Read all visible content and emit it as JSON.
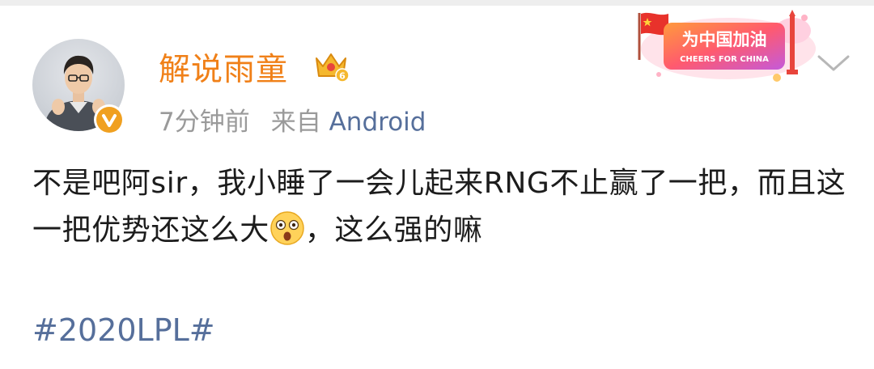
{
  "post": {
    "author": {
      "name": "解说雨童",
      "vip_level": "6",
      "avatar_icon": "person-avatar",
      "verified_icon": "verified-v-icon"
    },
    "meta": {
      "time": "7分钟前",
      "source_prefix": "来自",
      "source": "Android"
    },
    "banner": {
      "title": "为中国加油",
      "subtitle": "CHEERS FOR CHINA"
    },
    "text_part1": "不是吧阿sir，我小睡了一会儿起来RNG不止赢了一把，而且这一把优势还这么大",
    "text_emoji": "surprised-face-emoji",
    "text_part2": "，这么强的嘛",
    "hashtag": "#2020LPL#"
  },
  "colors": {
    "username": "#f08018",
    "link": "#566f9b",
    "meta": "#9a9a9a",
    "text": "#1c1c1c",
    "verified": "#f0a020"
  }
}
